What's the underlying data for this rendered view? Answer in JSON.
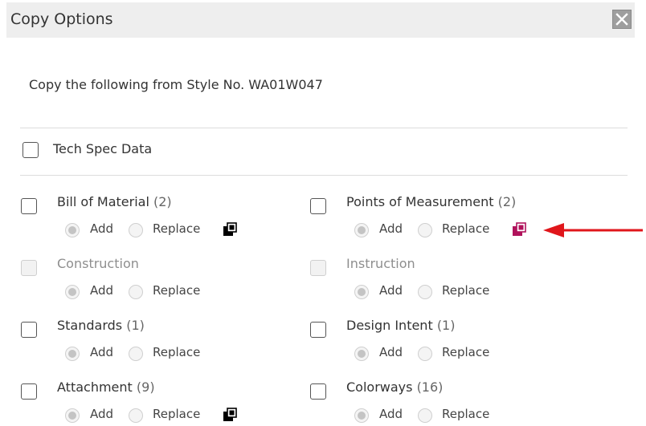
{
  "dialog": {
    "title": "Copy Options",
    "subtitle": "Copy the following from Style No. WA01W047"
  },
  "tech_spec": {
    "label": "Tech Spec Data",
    "checked": false
  },
  "items": [
    {
      "id": "bom",
      "label": "Bill of Material",
      "count": "(2)",
      "enabled": true,
      "mode": "Add",
      "has_copy_icon": true,
      "icon_color": "#000000"
    },
    {
      "id": "pom",
      "label": "Points of Measurement",
      "count": "(2)",
      "enabled": true,
      "mode": "Add",
      "has_copy_icon": true,
      "icon_color": "#b0125b"
    },
    {
      "id": "construction",
      "label": "Construction",
      "count": "",
      "enabled": false,
      "mode": "Add",
      "has_copy_icon": false
    },
    {
      "id": "instruction",
      "label": "Instruction",
      "count": "",
      "enabled": false,
      "mode": "Add",
      "has_copy_icon": false
    },
    {
      "id": "standards",
      "label": "Standards",
      "count": "(1)",
      "enabled": true,
      "mode": "Add",
      "has_copy_icon": false
    },
    {
      "id": "design-intent",
      "label": "Design Intent",
      "count": "(1)",
      "enabled": true,
      "mode": "Add",
      "has_copy_icon": false
    },
    {
      "id": "attachment",
      "label": "Attachment",
      "count": "(9)",
      "enabled": true,
      "mode": "Add",
      "has_copy_icon": true,
      "icon_color": "#000000"
    },
    {
      "id": "colorways",
      "label": "Colorways",
      "count": "(16)",
      "enabled": true,
      "mode": "Add",
      "has_copy_icon": false
    }
  ],
  "radio_labels": {
    "add": "Add",
    "replace": "Replace"
  },
  "colors": {
    "accent_arrow": "#e0161b",
    "copy_icon_active": "#b0125b",
    "titlebar_bg": "#eeeeee"
  },
  "icons": {
    "close": "close-icon",
    "copy": "copy-icon",
    "arrow": "arrow-icon"
  }
}
